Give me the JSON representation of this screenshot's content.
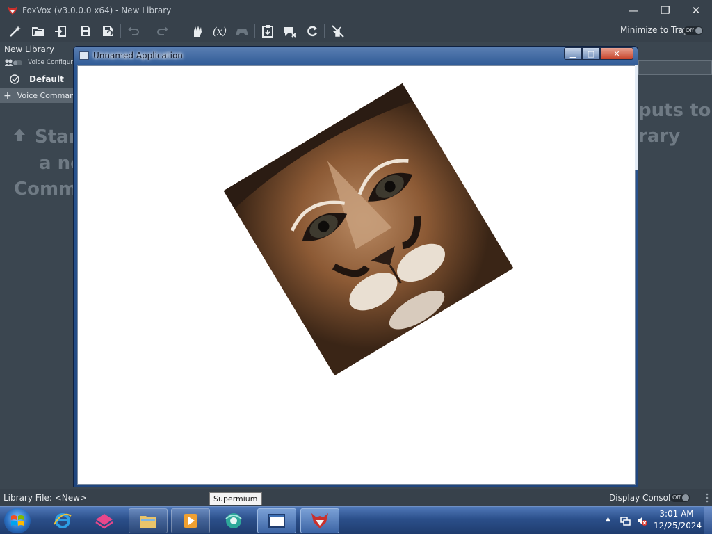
{
  "window": {
    "title": "FoxVox (v3.0.0.0 x64) - New Library",
    "minimize_glyph": "—",
    "restore_glyph": "❐",
    "close_glyph": "✕"
  },
  "toolbar": {
    "icons": [
      "magic-wand-icon",
      "open-folder-icon",
      "import-icon",
      "save-icon",
      "save-as-icon",
      "undo-icon",
      "redo-icon",
      "hand-icon",
      "variables-icon",
      "gamepad-icon",
      "clipboard-icon",
      "speech-mute-icon",
      "refresh-icon",
      "mic-off-icon"
    ],
    "variables_label": "(x)",
    "minimize_to_tray_label": "Minimize to Tray",
    "minimize_to_tray_state": "Off"
  },
  "left_panel": {
    "library_name": "New Library",
    "voice_configuration_label": "Voice Configura",
    "profile_name": "Default",
    "voice_commands_label": "Voice Comman"
  },
  "background_text": {
    "line1": "Star",
    "line2": "a ne",
    "line3": "Comm",
    "right1": "puts to",
    "right2": "rary"
  },
  "popup": {
    "title": "Unnamed Application",
    "min_glyph": "▁",
    "max_glyph": "□",
    "close_glyph": "✕"
  },
  "statusbar": {
    "library_file": "Library File: <New>",
    "display_console_label": "Display Console",
    "display_console_state": "Off"
  },
  "taskbar": {
    "tooltip": "Supermium",
    "time": "3:01 AM",
    "date": "12/25/2024",
    "buttons": [
      "windows-start-icon",
      "internet-explorer-icon",
      "pink-app-icon",
      "file-explorer-icon",
      "media-player-icon",
      "supermium-icon",
      "window-icon",
      "foxvox-icon"
    ]
  },
  "colors": {
    "app_bg": "#3b4650",
    "titlebar": "#37414b",
    "popup_frame": "#2b5793",
    "taskbar": "#2b4f8a"
  }
}
